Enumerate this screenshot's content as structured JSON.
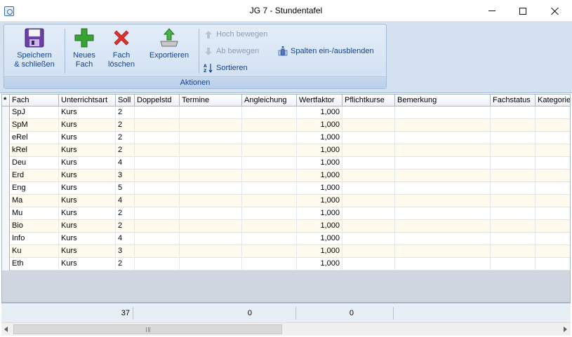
{
  "window": {
    "title": "JG 7 - Stundentafel"
  },
  "ribbon": {
    "group_caption": "Aktionen",
    "save_label": "Speichern\n& schließen",
    "new_label": "Neues\nFach",
    "delete_label": "Fach\nlöschen",
    "export_label": "Exportieren",
    "move_up_label": "Hoch bewegen",
    "move_down_label": "Ab bewegen",
    "sort_label": "Sortieren",
    "columns_label": "Spalten ein-/ausblenden"
  },
  "grid": {
    "new_row_marker": "*",
    "columns": [
      "Fach",
      "Unterrichtsart",
      "Soll",
      "Doppelstd",
      "Termine",
      "Angleichung",
      "Wertfaktor",
      "Pflichtkurse",
      "Bemerkung",
      "Fachstatus",
      "Kategorie"
    ],
    "rows": [
      {
        "fach": "SpJ",
        "art": "Kurs",
        "soll": "2",
        "wertfaktor": "1,000"
      },
      {
        "fach": "SpM",
        "art": "Kurs",
        "soll": "2",
        "wertfaktor": "1,000"
      },
      {
        "fach": "eRel",
        "art": "Kurs",
        "soll": "2",
        "wertfaktor": "1,000"
      },
      {
        "fach": "kRel",
        "art": "Kurs",
        "soll": "2",
        "wertfaktor": "1,000"
      },
      {
        "fach": "Deu",
        "art": "Kurs",
        "soll": "4",
        "wertfaktor": "1,000"
      },
      {
        "fach": "Erd",
        "art": "Kurs",
        "soll": "3",
        "wertfaktor": "1,000"
      },
      {
        "fach": "Eng",
        "art": "Kurs",
        "soll": "5",
        "wertfaktor": "1,000"
      },
      {
        "fach": "Ma",
        "art": "Kurs",
        "soll": "4",
        "wertfaktor": "1,000"
      },
      {
        "fach": "Mu",
        "art": "Kurs",
        "soll": "2",
        "wertfaktor": "1,000"
      },
      {
        "fach": "Bio",
        "art": "Kurs",
        "soll": "2",
        "wertfaktor": "1,000"
      },
      {
        "fach": "Info",
        "art": "Kurs",
        "soll": "4",
        "wertfaktor": "1,000"
      },
      {
        "fach": "Ku",
        "art": "Kurs",
        "soll": "3",
        "wertfaktor": "1,000"
      },
      {
        "fach": "Eth",
        "art": "Kurs",
        "soll": "2",
        "wertfaktor": "1,000"
      }
    ]
  },
  "summary": {
    "soll_total": "37",
    "angleichung_total": "0",
    "pflichtkurse_total": "0"
  },
  "colors": {
    "ribbon_text": "#15428b",
    "odd_row": "#fefbee"
  }
}
